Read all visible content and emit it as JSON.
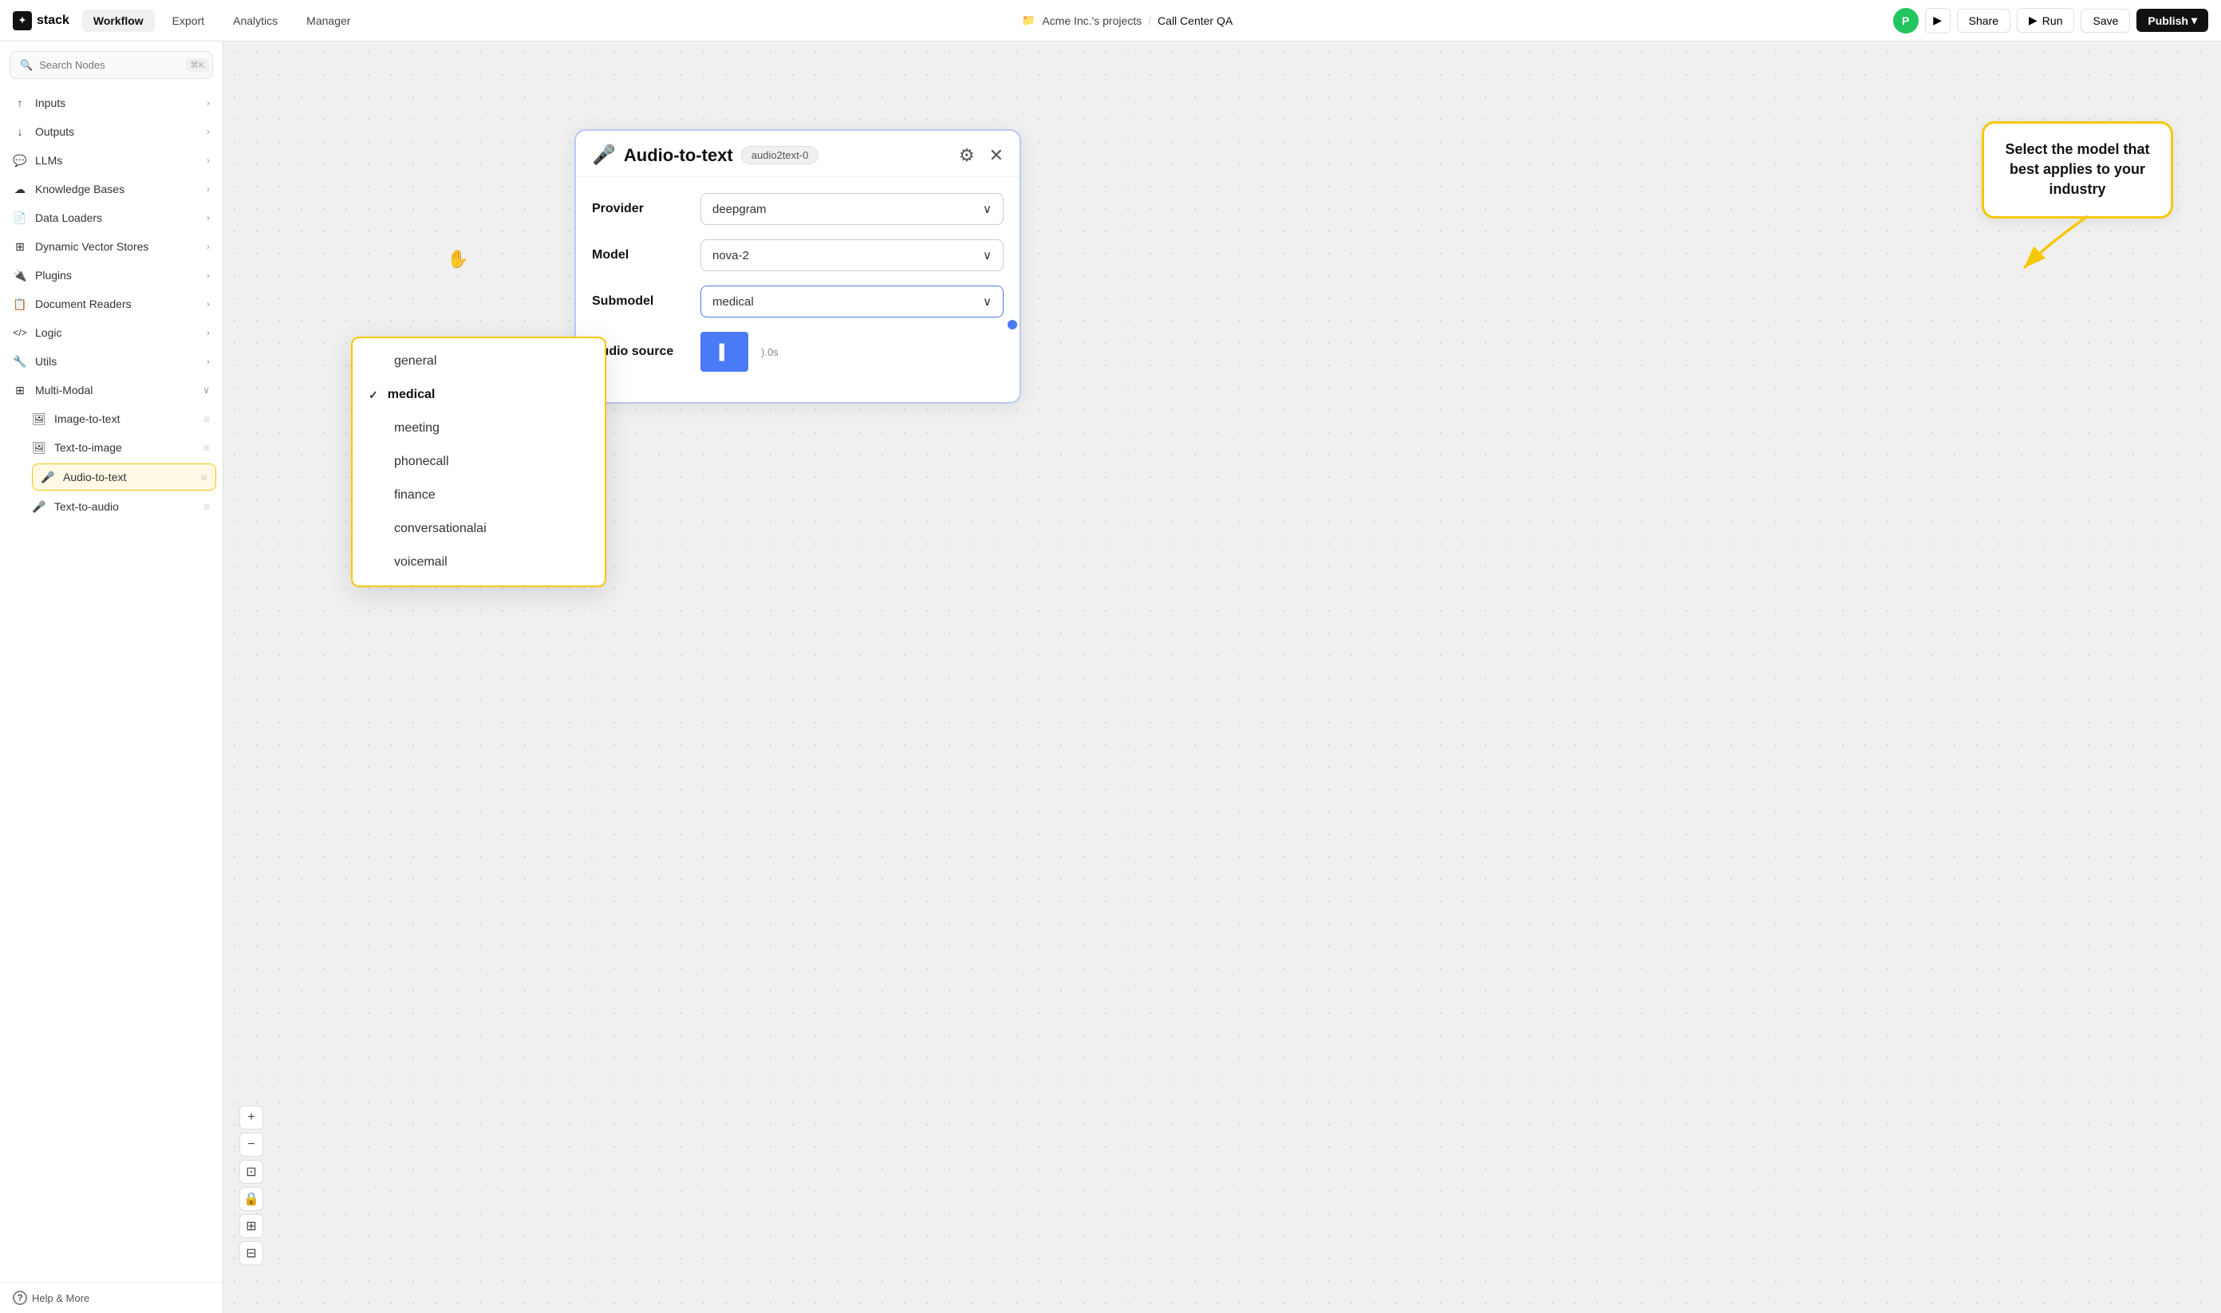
{
  "brand": {
    "name": "stack",
    "icon_label": "S"
  },
  "topnav": {
    "tabs": [
      {
        "id": "workflow",
        "label": "Workflow",
        "active": true
      },
      {
        "id": "export",
        "label": "Export",
        "active": false
      },
      {
        "id": "analytics",
        "label": "Analytics",
        "active": false
      },
      {
        "id": "manager",
        "label": "Manager",
        "active": false
      }
    ],
    "project": "Acme Inc.'s projects",
    "separator": "/",
    "page": "Call Center QA",
    "share_label": "Share",
    "run_label": "Run",
    "save_label": "Save",
    "publish_label": "Publish",
    "avatar_initials": "P"
  },
  "sidebar": {
    "search_placeholder": "Search Nodes",
    "search_shortcut": "⌘K",
    "items": [
      {
        "id": "inputs",
        "label": "Inputs",
        "icon": "↑",
        "has_children": true
      },
      {
        "id": "outputs",
        "label": "Outputs",
        "icon": "↓",
        "has_children": true
      },
      {
        "id": "llms",
        "label": "LLMs",
        "icon": "💬",
        "has_children": true
      },
      {
        "id": "knowledge-bases",
        "label": "Knowledge Bases",
        "icon": "☁",
        "has_children": true
      },
      {
        "id": "data-loaders",
        "label": "Data Loaders",
        "icon": "📄",
        "has_children": true
      },
      {
        "id": "dynamic-vector-stores",
        "label": "Dynamic Vector Stores",
        "icon": "⊞",
        "has_children": true
      },
      {
        "id": "plugins",
        "label": "Plugins",
        "icon": "🔌",
        "has_children": true
      },
      {
        "id": "document-readers",
        "label": "Document Readers",
        "icon": "📋",
        "has_children": true
      },
      {
        "id": "logic",
        "label": "Logic",
        "icon": "</>",
        "has_children": true
      },
      {
        "id": "utils",
        "label": "Utils",
        "icon": "🔧",
        "has_children": true
      },
      {
        "id": "multi-modal",
        "label": "Multi-Modal",
        "icon": "⊞",
        "expanded": true
      }
    ],
    "multi_modal_children": [
      {
        "id": "image-to-text",
        "label": "Image-to-text"
      },
      {
        "id": "text-to-image",
        "label": "Text-to-image"
      },
      {
        "id": "audio-to-text",
        "label": "Audio-to-text",
        "active": true
      },
      {
        "id": "text-to-audio",
        "label": "Text-to-audio"
      }
    ],
    "help_label": "Help & More"
  },
  "node": {
    "title": "Audio-to-text",
    "badge": "audio2text-0",
    "mic_icon": "🎤",
    "fields": {
      "provider_label": "Provider",
      "provider_value": "deepgram",
      "model_label": "Model",
      "model_value": "nova-2",
      "submodel_label": "Submodel",
      "submodel_value": "medical",
      "audio_source_label": "Audio source"
    },
    "dropdown": {
      "options": [
        {
          "value": "general",
          "label": "general",
          "selected": false
        },
        {
          "value": "medical",
          "label": "medical",
          "selected": true
        },
        {
          "value": "meeting",
          "label": "meeting",
          "selected": false
        },
        {
          "value": "phonecall",
          "label": "phonecall",
          "selected": false
        },
        {
          "value": "finance",
          "label": "finance",
          "selected": false
        },
        {
          "value": "conversationalai",
          "label": "conversationalai",
          "selected": false
        },
        {
          "value": "voicemail",
          "label": "voicemail",
          "selected": false
        }
      ]
    }
  },
  "tooltip": {
    "text": "Select the model that best applies to your industry"
  },
  "zoom_controls": {
    "plus": "+",
    "minus": "−",
    "fit": "⊡",
    "lock": "🔒",
    "grid": "⊞",
    "map": "⊟"
  }
}
